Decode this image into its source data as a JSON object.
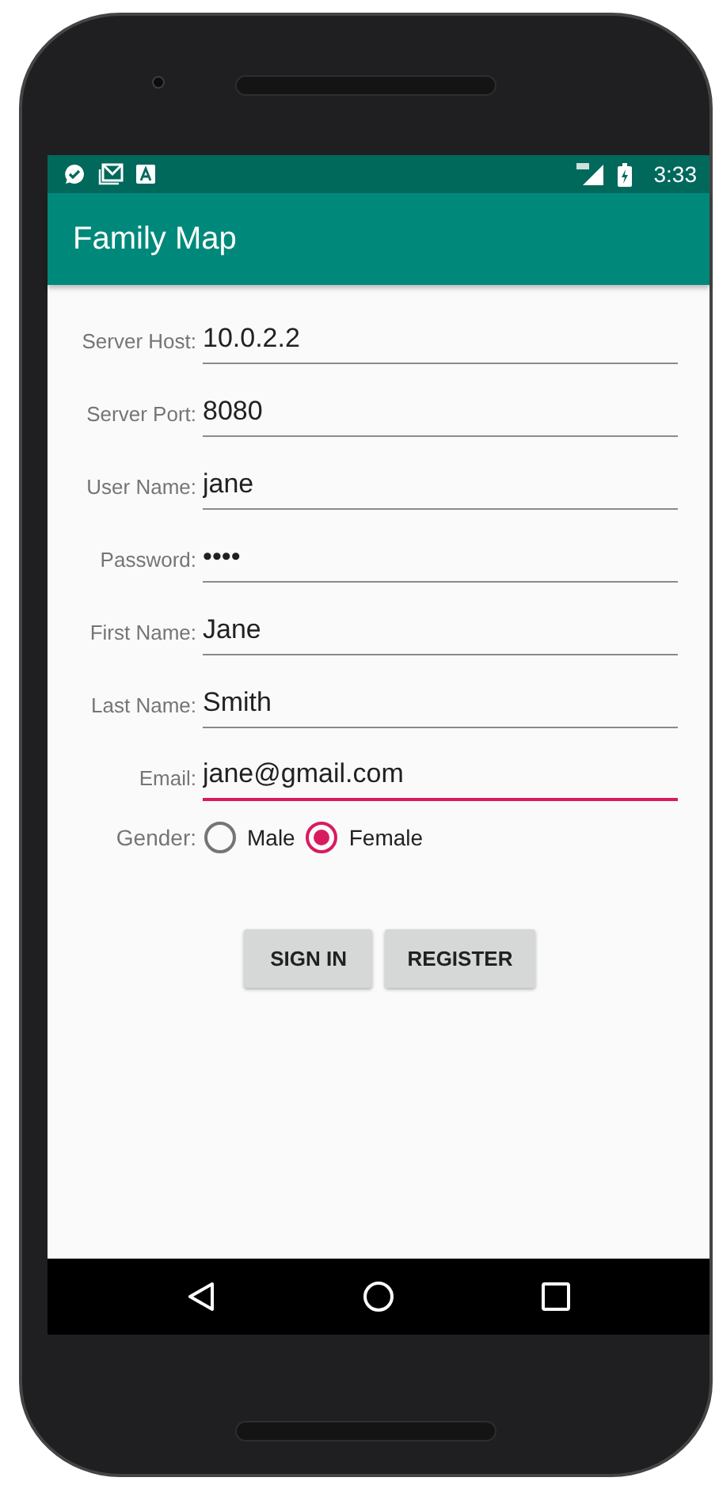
{
  "status_bar": {
    "time": "3:33"
  },
  "app_bar": {
    "title": "Family Map"
  },
  "form": {
    "fields": [
      {
        "label": "Server Host:",
        "value": "10.0.2.2",
        "focused": false
      },
      {
        "label": "Server Port:",
        "value": "8080",
        "focused": false
      },
      {
        "label": "User Name:",
        "value": "jane",
        "focused": false
      },
      {
        "label": "Password:",
        "value": "••••",
        "focused": false
      },
      {
        "label": "First Name:",
        "value": "Jane",
        "focused": false
      },
      {
        "label": "Last Name:",
        "value": "Smith",
        "focused": false
      },
      {
        "label": "Email:",
        "value": "jane@gmail.com",
        "focused": true
      }
    ],
    "gender": {
      "label": "Gender:",
      "options": [
        {
          "label": "Male",
          "selected": false
        },
        {
          "label": "Female",
          "selected": true
        }
      ]
    },
    "buttons": [
      "SIGN IN",
      "REGISTER"
    ]
  }
}
